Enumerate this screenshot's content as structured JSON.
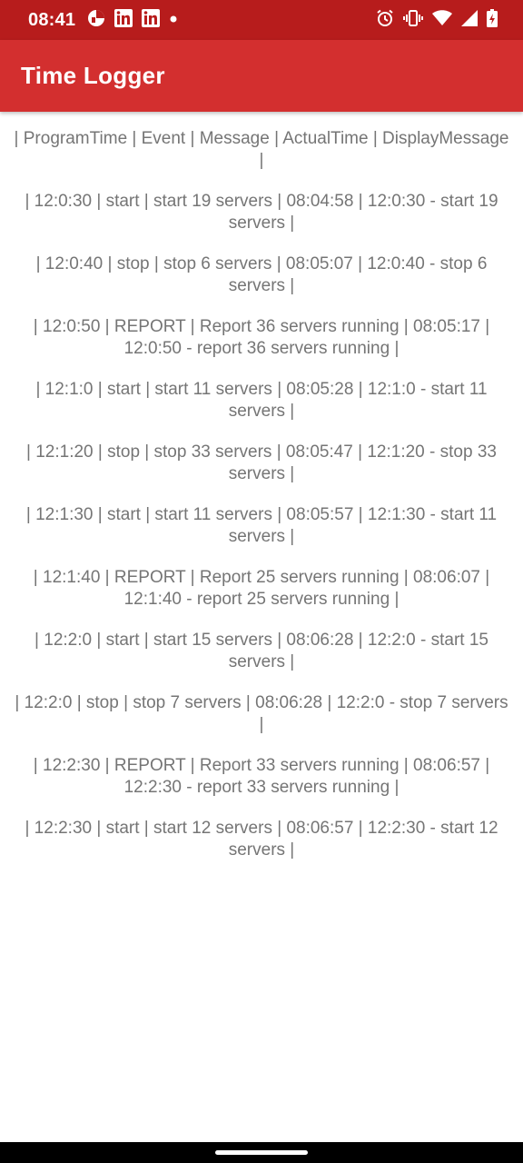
{
  "status_bar": {
    "time": "08:41",
    "background_color": "#b71c1c",
    "left_icons": [
      "app-notification-icon",
      "linkedin-icon",
      "linkedin-icon",
      "notification-dot-icon"
    ],
    "right_icons": [
      "alarm-icon",
      "vibrate-icon",
      "wifi-icon",
      "signal-icon",
      "battery-charging-icon"
    ]
  },
  "app_bar": {
    "title": "Time Logger",
    "background_color": "#d32f2f"
  },
  "log": {
    "text_color": "#757575",
    "lines": [
      "| ProgramTime | Event | Message | ActualTime | DisplayMessage |",
      "| 12:0:30 | start | start 19 servers | 08:04:58 | 12:0:30 - start 19 servers |",
      "| 12:0:40 | stop | stop 6 servers | 08:05:07 | 12:0:40 - stop 6 servers |",
      "| 12:0:50 | REPORT | Report 36 servers running | 08:05:17 | 12:0:50 - report 36 servers running |",
      "| 12:1:0 | start | start 11 servers | 08:05:28 | 12:1:0 - start 11 servers |",
      "| 12:1:20 | stop | stop 33 servers | 08:05:47 | 12:1:20 - stop 33 servers |",
      "| 12:1:30 | start | start 11 servers | 08:05:57 | 12:1:30 - start 11 servers |",
      "| 12:1:40 | REPORT | Report 25 servers running | 08:06:07 | 12:1:40 - report 25 servers running |",
      "| 12:2:0 | start | start 15 servers | 08:06:28 | 12:2:0 - start 15 servers |",
      "| 12:2:0 | stop | stop 7 servers | 08:06:28 | 12:2:0 - stop 7 servers |",
      "| 12:2:30 | REPORT | Report 33 servers running | 08:06:57 | 12:2:30 - report 33 servers running |",
      "| 12:2:30 | start | start 12 servers | 08:06:57 | 12:2:30 - start 12 servers |"
    ]
  },
  "nav_bar": {
    "handle_icon": "home-gesture-handle"
  }
}
